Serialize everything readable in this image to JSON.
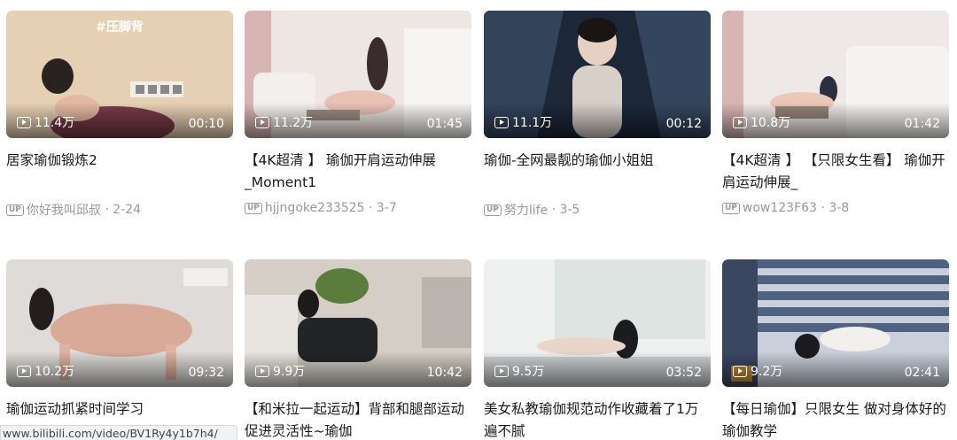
{
  "videos": [
    {
      "tag": "#压脚背",
      "views": "11.4万",
      "duration": "00:10",
      "title": "居家瑜伽锻炼2",
      "author": "你好我叫邱叔",
      "date": "2-24",
      "colors": [
        "#e8d2b6",
        "#d9bf9f"
      ]
    },
    {
      "tag": "",
      "views": "11.2万",
      "duration": "01:45",
      "title": "【4K超清 】 瑜伽开肩运动伸展_Moment1",
      "author": "hjjngoke233525",
      "date": "3-7",
      "colors": [
        "#efe9e6",
        "#d9cfcc"
      ]
    },
    {
      "tag": "",
      "views": "11.1万",
      "duration": "00:12",
      "title": "瑜伽-全网最靓的瑜伽小姐姐",
      "author": "努力life",
      "date": "3-5",
      "colors": [
        "#1d2a3c",
        "#4b5c74"
      ]
    },
    {
      "tag": "",
      "views": "10.8万",
      "duration": "01:42",
      "title": "【4K超清 】 【只限女生看】 瑜伽开肩运动伸展_",
      "author": "wow123F63",
      "date": "3-8",
      "colors": [
        "#f0ecea",
        "#ddd5d2"
      ]
    },
    {
      "tag": "",
      "views": "10.2万",
      "duration": "09:32",
      "title": "瑜伽运动抓紧时间学习",
      "author": "",
      "date": "",
      "colors": [
        "#dcdad8",
        "#c9c4c0"
      ]
    },
    {
      "tag": "",
      "views": "9.9万",
      "duration": "10:42",
      "title": "【和米拉一起运动】背部和腿部运动促进灵活性~瑜伽",
      "author": "",
      "date": "",
      "colors": [
        "#d8d3cc",
        "#b9b2a9"
      ]
    },
    {
      "tag": "",
      "views": "9.5万",
      "duration": "03:52",
      "title": "美女私教瑜伽规范动作收藏着了1万遍不腻",
      "author": "",
      "date": "",
      "colors": [
        "#eef0ef",
        "#d7dbd9"
      ]
    },
    {
      "tag": "",
      "views": "9.2万",
      "duration": "02:41",
      "title": "【每日瑜伽】只限女生 做对身体好的瑜伽教学",
      "author": "",
      "date": "",
      "colors": [
        "#5a6d8c",
        "#c8cfd9"
      ]
    }
  ],
  "url_bar": "www.bilibili.com/video/BV1Ry4y1b7h4/",
  "up_badge": "UP"
}
